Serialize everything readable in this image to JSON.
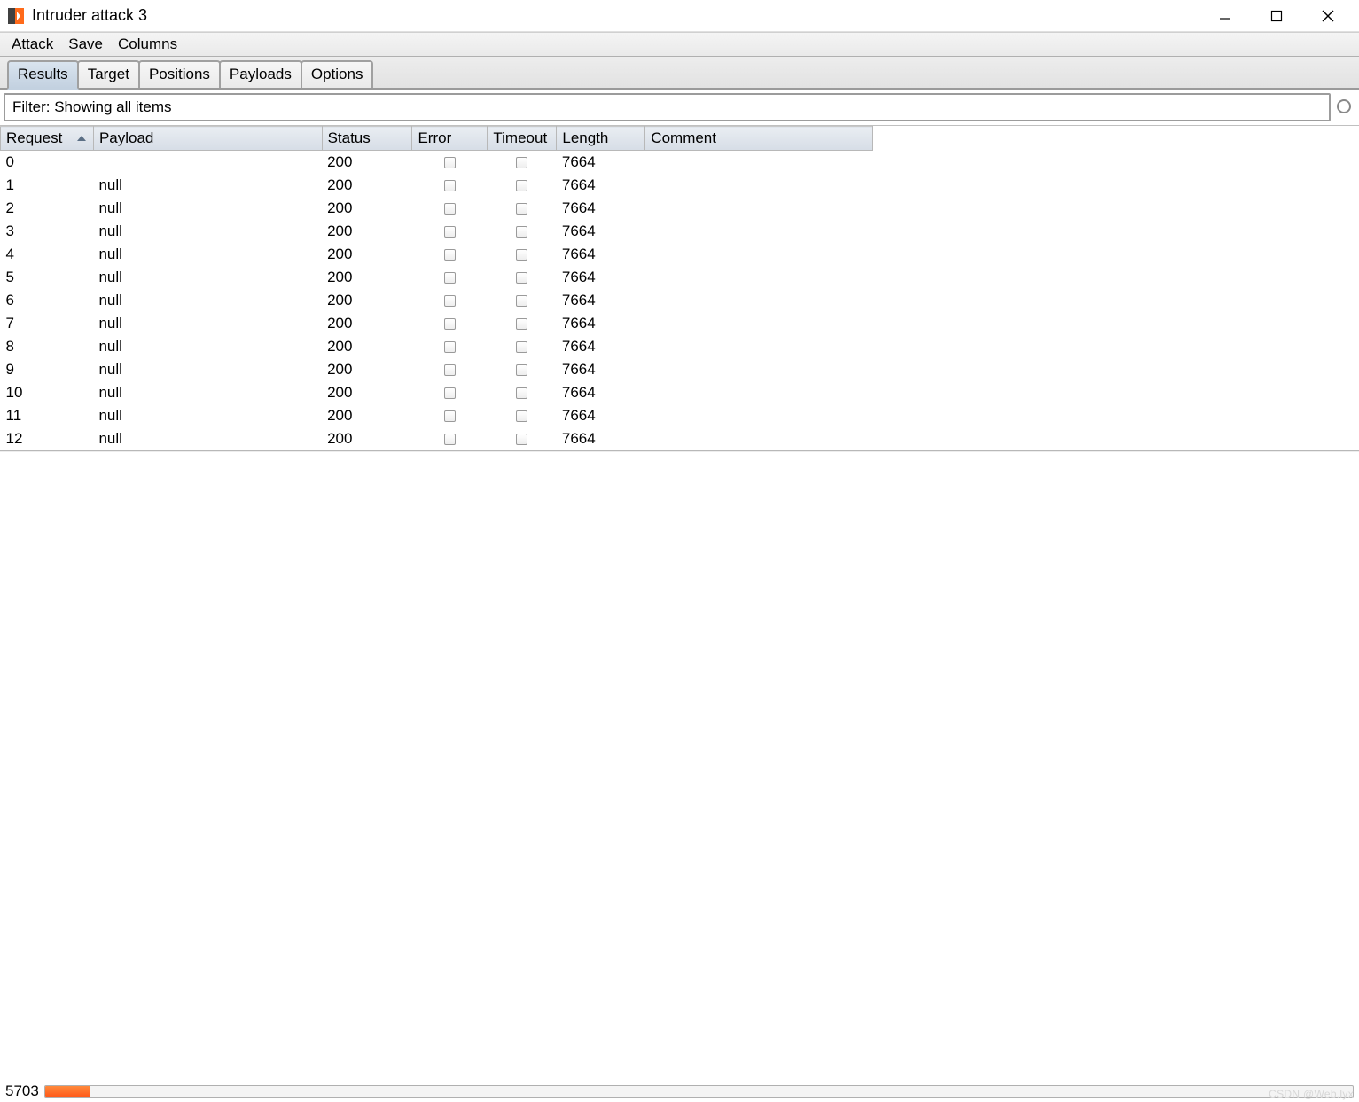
{
  "window": {
    "title": "Intruder attack 3"
  },
  "menubar": {
    "items": [
      "Attack",
      "Save",
      "Columns"
    ]
  },
  "tabs": {
    "items": [
      "Results",
      "Target",
      "Positions",
      "Payloads",
      "Options"
    ],
    "active_index": 0
  },
  "filter": {
    "text": "Filter: Showing all items"
  },
  "table": {
    "columns": [
      "Request",
      "Payload",
      "Status",
      "Error",
      "Timeout",
      "Length",
      "Comment"
    ],
    "sorted_column_index": 0,
    "rows": [
      {
        "request": "0",
        "payload": "",
        "status": "200",
        "error": false,
        "timeout": false,
        "length": "7664",
        "comment": ""
      },
      {
        "request": "1",
        "payload": "null",
        "status": "200",
        "error": false,
        "timeout": false,
        "length": "7664",
        "comment": ""
      },
      {
        "request": "2",
        "payload": "null",
        "status": "200",
        "error": false,
        "timeout": false,
        "length": "7664",
        "comment": ""
      },
      {
        "request": "3",
        "payload": "null",
        "status": "200",
        "error": false,
        "timeout": false,
        "length": "7664",
        "comment": ""
      },
      {
        "request": "4",
        "payload": "null",
        "status": "200",
        "error": false,
        "timeout": false,
        "length": "7664",
        "comment": ""
      },
      {
        "request": "5",
        "payload": "null",
        "status": "200",
        "error": false,
        "timeout": false,
        "length": "7664",
        "comment": ""
      },
      {
        "request": "6",
        "payload": "null",
        "status": "200",
        "error": false,
        "timeout": false,
        "length": "7664",
        "comment": ""
      },
      {
        "request": "7",
        "payload": "null",
        "status": "200",
        "error": false,
        "timeout": false,
        "length": "7664",
        "comment": ""
      },
      {
        "request": "8",
        "payload": "null",
        "status": "200",
        "error": false,
        "timeout": false,
        "length": "7664",
        "comment": ""
      },
      {
        "request": "9",
        "payload": "null",
        "status": "200",
        "error": false,
        "timeout": false,
        "length": "7664",
        "comment": ""
      },
      {
        "request": "10",
        "payload": "null",
        "status": "200",
        "error": false,
        "timeout": false,
        "length": "7664",
        "comment": ""
      },
      {
        "request": "11",
        "payload": "null",
        "status": "200",
        "error": false,
        "timeout": false,
        "length": "7664",
        "comment": ""
      },
      {
        "request": "12",
        "payload": "null",
        "status": "200",
        "error": false,
        "timeout": false,
        "length": "7664",
        "comment": ""
      }
    ]
  },
  "statusbar": {
    "count": "5703"
  },
  "watermark": "CSDN @Web.lyx"
}
